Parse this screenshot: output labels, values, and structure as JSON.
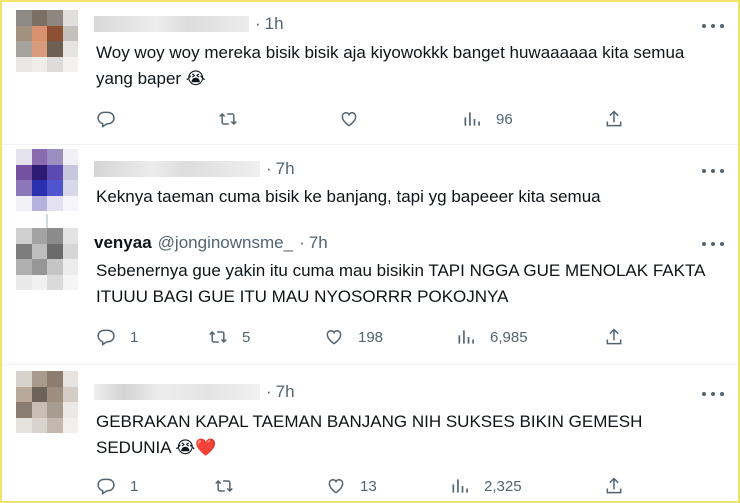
{
  "tweets": [
    {
      "time": "1h",
      "text": "Woy woy woy mereka bisik bisik aja kiyowokkk banget huwaaaaaa kita semua yang baper 😭",
      "views": "96"
    },
    {
      "time": "7h",
      "text": "Keknya taeman cuma bisik ke banjang, tapi yg bapeeer kita semua"
    },
    {
      "display_name": "venyaa",
      "handle": "@jonginownsme_",
      "time": "7h",
      "text": "Sebenernya gue yakin itu cuma mau bisikin TAPI NGGA GUE MENOLAK FAKTA ITUUU BAGI GUE ITU MAU NYOSORRR POKOJNYA",
      "replies": "1",
      "retweets": "5",
      "likes": "198",
      "views": "6,985"
    },
    {
      "time": "7h",
      "text": "GEBRAKAN KAPAL TAEMAN BANJANG NIH SUKSES BIKIN GEMESH SEDUNIA 😭❤️",
      "replies": "1",
      "likes": "13",
      "views": "2,325"
    }
  ],
  "separator": "·",
  "icons": [
    "reply-icon",
    "retweet-icon",
    "like-icon",
    "views-icon",
    "share-icon",
    "more-icon"
  ],
  "colors": {
    "secondary_text": "#536471",
    "divider": "#eff3f4",
    "border": "#f2e36a"
  }
}
